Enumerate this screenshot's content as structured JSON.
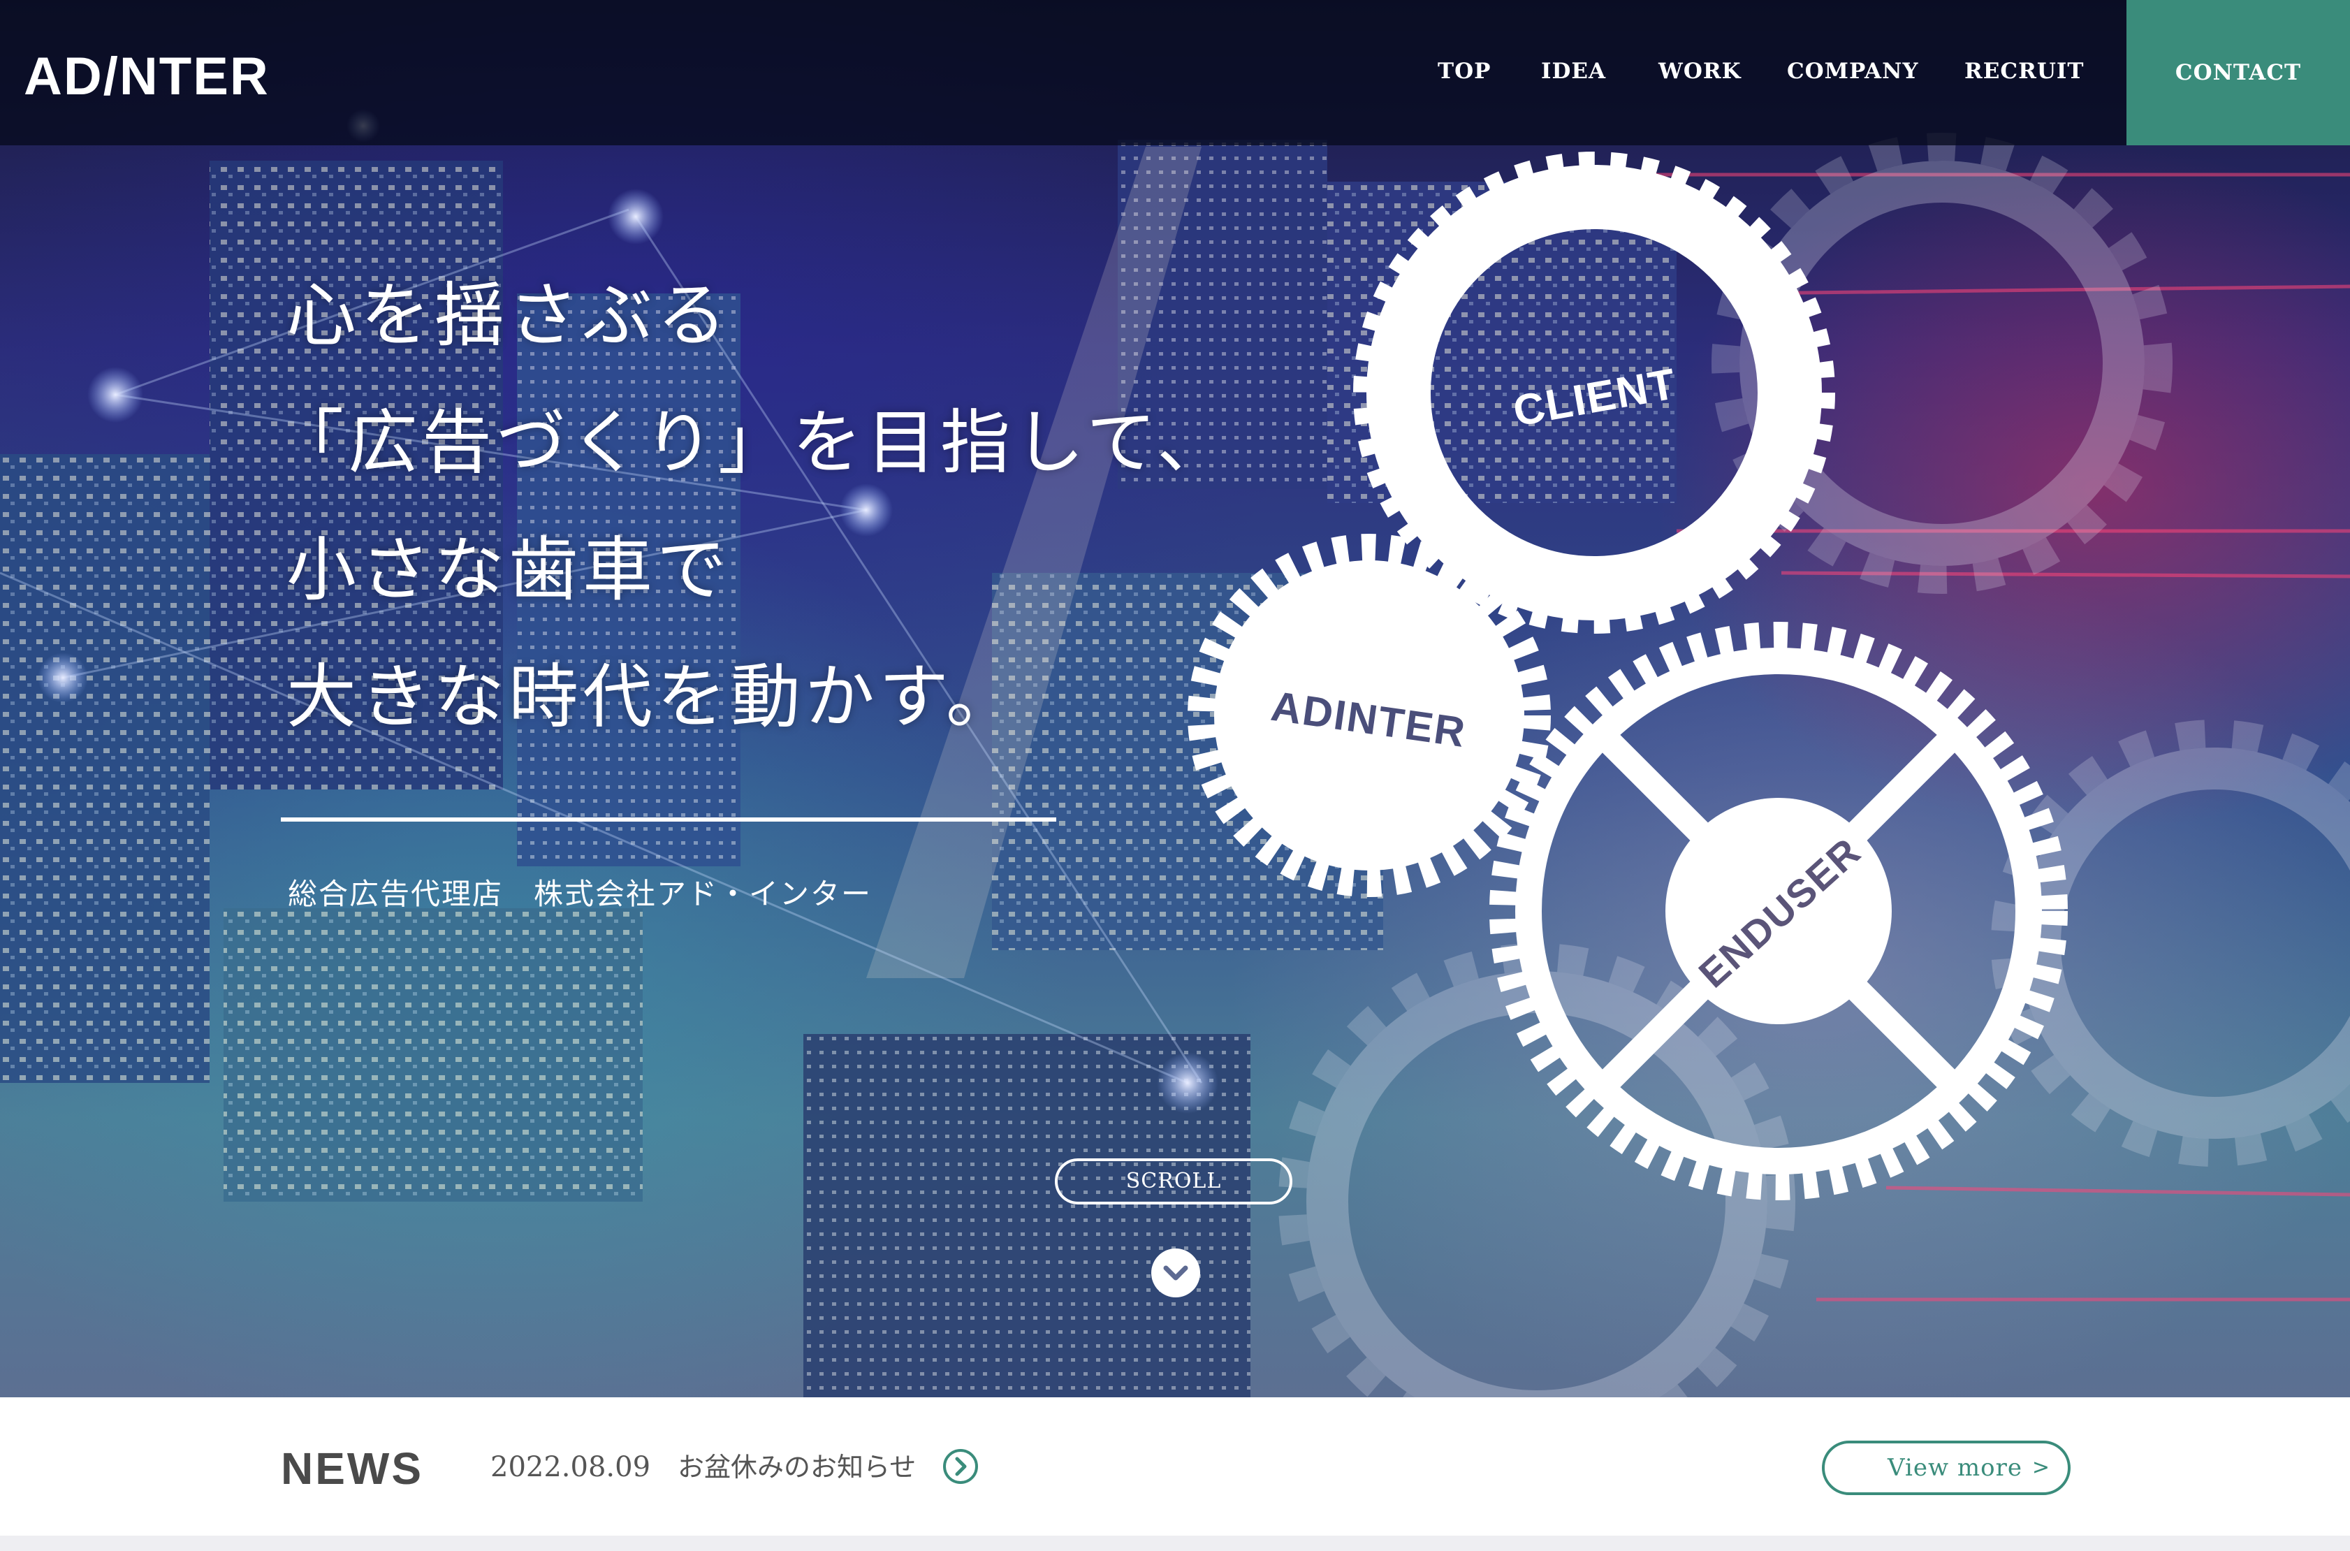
{
  "header": {
    "logo_text": "AD/NTER",
    "nav": [
      "TOP",
      "IDEA",
      "WORK",
      "COMPANY",
      "RECRUIT"
    ],
    "contact_label": "CONTACT",
    "accent_color": "#3a8c7b"
  },
  "hero": {
    "copy_lines": [
      "心を揺さぶる",
      "「広告づくり」を目指して、",
      "小さな歯車で",
      "大きな時代を動かす。"
    ],
    "subtitle": "総合広告代理店　株式会社アド・インター",
    "gears": {
      "client_label": "CLIENT",
      "adinter_label": "ADINTER",
      "enduser_label": "ENDUSER"
    },
    "scroll_label": "SCROLL",
    "scroll_icon": "chevron-down-icon"
  },
  "news": {
    "title": "NEWS",
    "date": "2022.08.09",
    "text": "お盆休みのお知らせ",
    "arrow_icon": "chevron-right-circle-icon",
    "view_more": "View more",
    "view_more_chevron": ">"
  }
}
